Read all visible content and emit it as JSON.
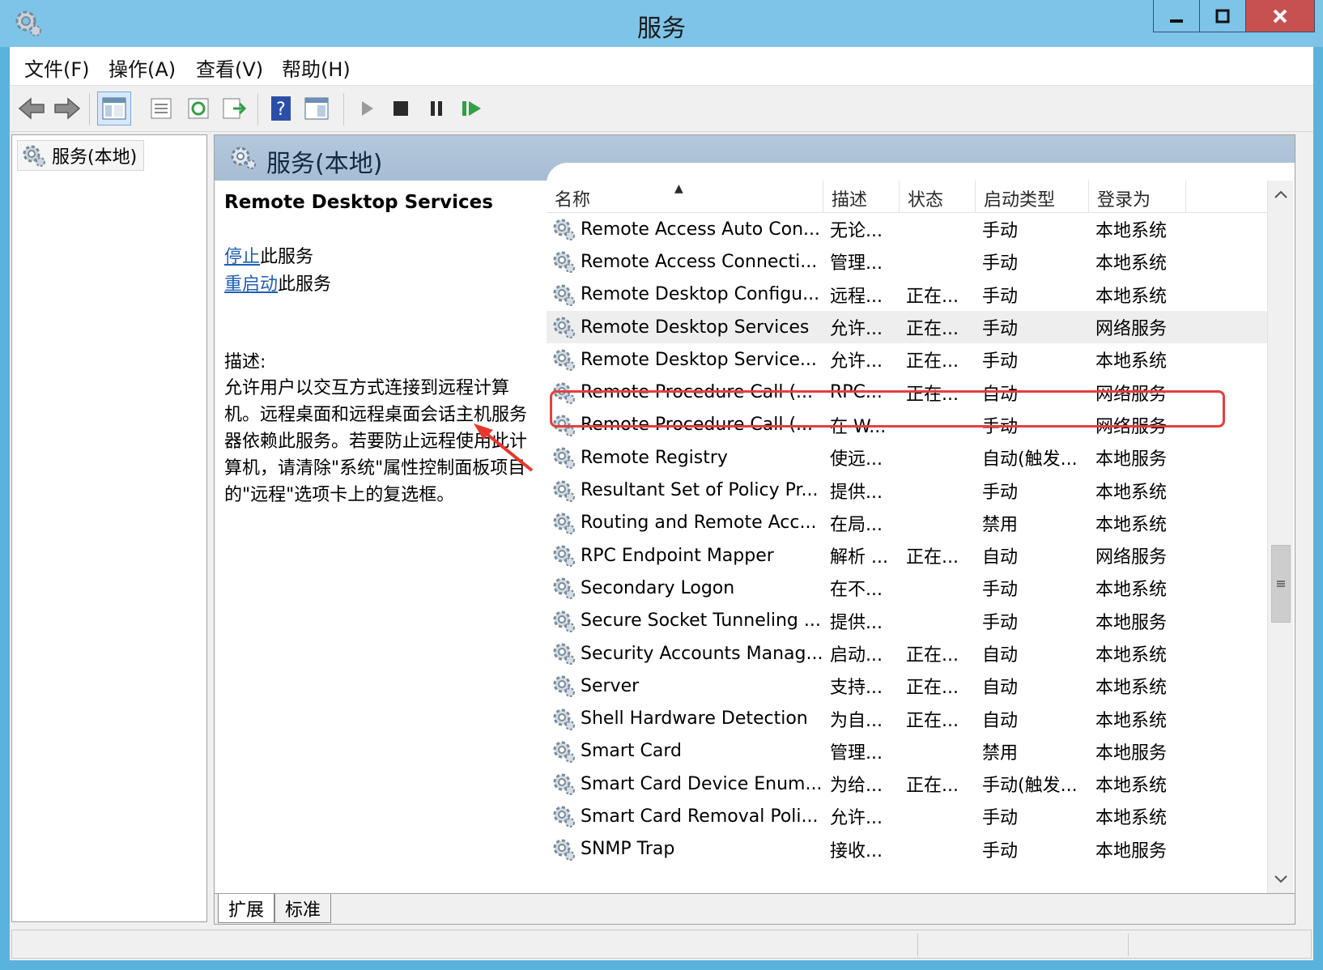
{
  "window": {
    "title": "服务"
  },
  "menu": [
    "文件(F)",
    "操作(A)",
    "查看(V)",
    "帮助(H)"
  ],
  "toolbar": [
    "back-icon",
    "forward-icon",
    "show-tree-icon",
    "properties-icon",
    "refresh-icon",
    "export-icon",
    "help-icon",
    "show-hide-icon",
    "start-icon",
    "stop-icon",
    "pause-icon",
    "resume-icon"
  ],
  "tree": {
    "root": "服务(本地)"
  },
  "main": {
    "title": "服务(本地)"
  },
  "detail": {
    "service_name": "Remote Desktop Services",
    "stop_link": "停止",
    "stop_suffix": "此服务",
    "restart_link": "重启动",
    "restart_suffix": "此服务",
    "desc_label": "描述:",
    "desc_text": "允许用户以交互方式连接到远程计算机。远程桌面和远程桌面会话主机服务器依赖此服务。若要防止远程使用此计算机，请清除\"系统\"属性控制面板项目的\"远程\"选项卡上的复选框。"
  },
  "columns": {
    "name": "名称",
    "desc": "描述",
    "status": "状态",
    "startup": "启动类型",
    "logon": "登录为"
  },
  "services": [
    {
      "name": "Remote Access Auto Con...",
      "desc": "无论...",
      "status": "",
      "startup": "手动",
      "logon": "本地系统"
    },
    {
      "name": "Remote Access Connecti...",
      "desc": "管理...",
      "status": "",
      "startup": "手动",
      "logon": "本地系统"
    },
    {
      "name": "Remote Desktop Configu...",
      "desc": "远程...",
      "status": "正在...",
      "startup": "手动",
      "logon": "本地系统"
    },
    {
      "name": "Remote Desktop Services",
      "desc": "允许...",
      "status": "正在...",
      "startup": "手动",
      "logon": "网络服务",
      "selected": true
    },
    {
      "name": "Remote Desktop Service...",
      "desc": "允许...",
      "status": "正在...",
      "startup": "手动",
      "logon": "本地系统"
    },
    {
      "name": "Remote Procedure Call (...",
      "desc": "RPC...",
      "status": "正在...",
      "startup": "自动",
      "logon": "网络服务"
    },
    {
      "name": "Remote Procedure Call (...",
      "desc": "在 W...",
      "status": "",
      "startup": "手动",
      "logon": "网络服务"
    },
    {
      "name": "Remote Registry",
      "desc": "使远...",
      "status": "",
      "startup": "自动(触发...",
      "logon": "本地服务"
    },
    {
      "name": "Resultant Set of Policy Pr...",
      "desc": "提供...",
      "status": "",
      "startup": "手动",
      "logon": "本地系统"
    },
    {
      "name": "Routing and Remote Acc...",
      "desc": "在局...",
      "status": "",
      "startup": "禁用",
      "logon": "本地系统"
    },
    {
      "name": "RPC Endpoint Mapper",
      "desc": "解析 ...",
      "status": "正在...",
      "startup": "自动",
      "logon": "网络服务"
    },
    {
      "name": "Secondary Logon",
      "desc": "在不...",
      "status": "",
      "startup": "手动",
      "logon": "本地系统"
    },
    {
      "name": "Secure Socket Tunneling ...",
      "desc": "提供...",
      "status": "",
      "startup": "手动",
      "logon": "本地服务"
    },
    {
      "name": "Security Accounts Manag...",
      "desc": "启动...",
      "status": "正在...",
      "startup": "自动",
      "logon": "本地系统"
    },
    {
      "name": "Server",
      "desc": "支持...",
      "status": "正在...",
      "startup": "自动",
      "logon": "本地系统"
    },
    {
      "name": "Shell Hardware Detection",
      "desc": "为自...",
      "status": "正在...",
      "startup": "自动",
      "logon": "本地系统"
    },
    {
      "name": "Smart Card",
      "desc": "管理...",
      "status": "",
      "startup": "禁用",
      "logon": "本地服务"
    },
    {
      "name": "Smart Card Device Enum...",
      "desc": "为给...",
      "status": "正在...",
      "startup": "手动(触发...",
      "logon": "本地系统"
    },
    {
      "name": "Smart Card Removal Poli...",
      "desc": "允许...",
      "status": "",
      "startup": "手动",
      "logon": "本地系统"
    },
    {
      "name": "SNMP Trap",
      "desc": "接收...",
      "status": "",
      "startup": "手动",
      "logon": "本地服务"
    }
  ],
  "tabs": [
    "扩展",
    "标准"
  ],
  "colors": {
    "title_bar": "#7ec4e8",
    "highlight_box": "#e53e3e",
    "link": "#1f5fb6",
    "header": "#a7bdd3"
  }
}
